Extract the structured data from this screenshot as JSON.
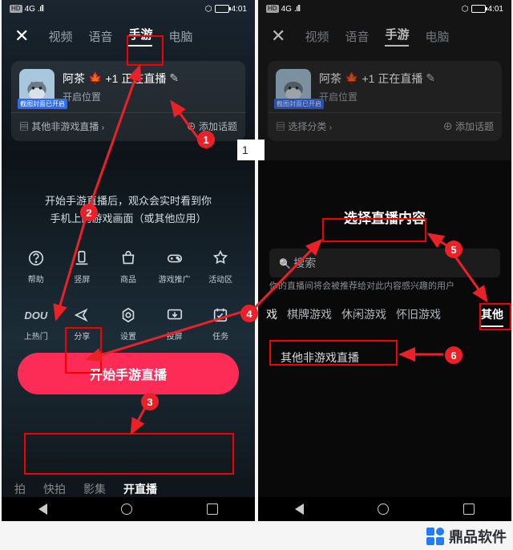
{
  "status": {
    "hd": "HD",
    "net": "4G",
    "hw": "⬡",
    "time": "4:01"
  },
  "tabs": {
    "video": "视频",
    "voice": "语音",
    "game": "手游",
    "pc": "电脑"
  },
  "card": {
    "avatar_badge": "截图封面已开启",
    "name": "阿茶",
    "plus": "+1",
    "live_suffix": "正在直播",
    "open_pos": "开启位置",
    "cat_left": "其他非游戏直播",
    "cat_right": "选择分类",
    "add_topic": "添加话题"
  },
  "step1_label": "1",
  "desc_l1": "开始手游直播后，观众会实时看到你",
  "desc_l2": "手机上的游戏画面（或其他应用）",
  "row1": {
    "help": "帮助",
    "orient": "竖屏",
    "shop": "商品",
    "recom": "游戏推广",
    "zone": "活动区"
  },
  "row2": {
    "dou": "DOU",
    "dou_s": "上热门",
    "share": "分享",
    "set": "设置",
    "cast": "投屏",
    "task": "任务"
  },
  "start_btn": "开始手游直播",
  "bottom": {
    "pai": "拍",
    "fast": "快拍",
    "movie": "影集",
    "live": "开直播"
  },
  "right": {
    "title": "选择直播内容",
    "search": "搜索",
    "hint": "你的直播间将会被推荐给对此内容感兴趣的用户",
    "cats": {
      "edge": "戏",
      "c1": "棋牌游戏",
      "c2": "休闲游戏",
      "c3": "怀旧游戏",
      "c4": "其他"
    },
    "chip": "其他非游戏直播"
  },
  "badges": {
    "1": "1",
    "2": "2",
    "3": "3",
    "4": "4",
    "5": "5",
    "6": "6"
  },
  "watermark": "鼎品软件"
}
